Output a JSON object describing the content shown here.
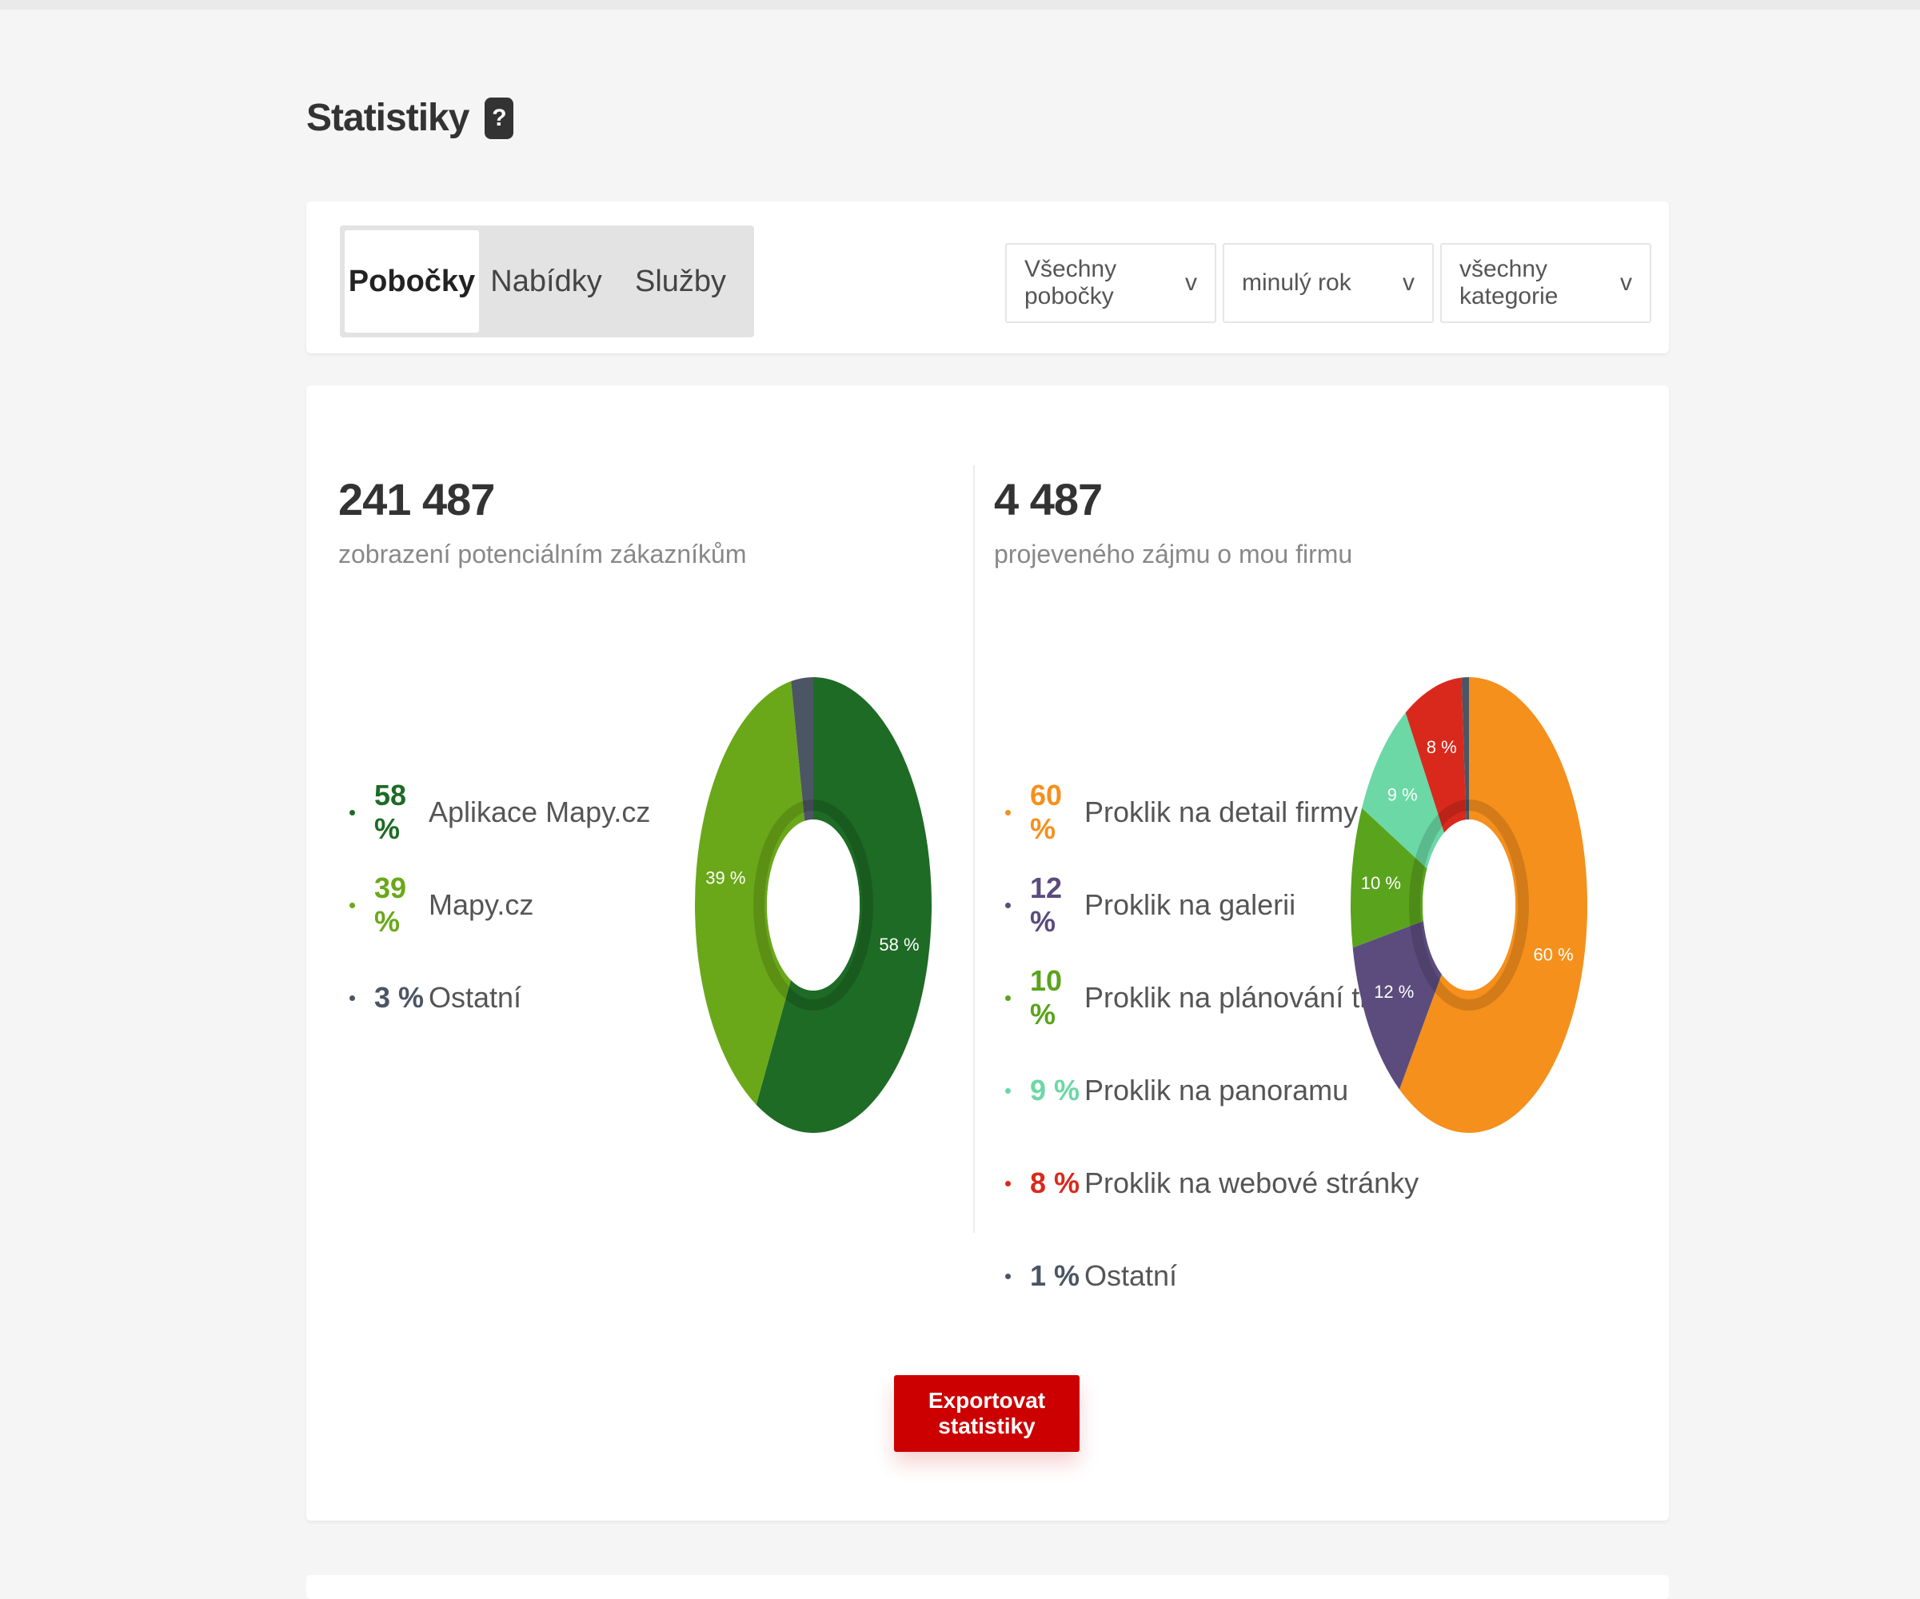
{
  "page": {
    "title": "Statistiky",
    "help_icon": "?"
  },
  "tabs": [
    {
      "label": "Pobočky",
      "active": true
    },
    {
      "label": "Nabídky",
      "active": false
    },
    {
      "label": "Služby",
      "active": false
    }
  ],
  "filters": {
    "branch": "Všechny pobočky",
    "period": "minulý rok",
    "category": "všechny kategorie",
    "chevron": "v"
  },
  "left_panel": {
    "number": "241 487",
    "subtitle": "zobrazení potenciálním zákazníkům",
    "legend": [
      {
        "pct": "58 %",
        "label": "Aplikace Mapy.cz",
        "color": "#1e6b25"
      },
      {
        "pct": "39 %",
        "label": "Mapy.cz",
        "color": "#6aa819"
      },
      {
        "pct": "3 %",
        "label": "Ostatní",
        "color": "#4c5564"
      }
    ]
  },
  "right_panel": {
    "number": "4 487",
    "subtitle": "projeveného zájmu o mou firmu",
    "legend": [
      {
        "pct": "60 %",
        "label": "Proklik na detail firmy",
        "color": "#f5901c"
      },
      {
        "pct": "12 %",
        "label": "Proklik na galerii",
        "color": "#5b4c7d"
      },
      {
        "pct": "10 %",
        "label": "Proklik na plánování trasy",
        "color": "#5aa31d"
      },
      {
        "pct": "9 %",
        "label": "Proklik na panoramu",
        "color": "#6bd8a6"
      },
      {
        "pct": "8 %",
        "label": "Proklik na webové stránky",
        "color": "#d9291d"
      },
      {
        "pct": "1 %",
        "label": "Ostatní",
        "color": "#4c5564"
      }
    ]
  },
  "export_button": "Exportovat statistiky",
  "chart_data": [
    {
      "type": "pie",
      "categories": [
        "Aplikace Mapy.cz",
        "Mapy.cz",
        "Ostatní"
      ],
      "values": [
        58,
        39,
        3
      ],
      "colors": [
        "#1e6b25",
        "#6aa819",
        "#4c5564"
      ],
      "slice_labels": [
        "58 %",
        "39 %",
        ""
      ]
    },
    {
      "type": "pie",
      "categories": [
        "Proklik na detail firmy",
        "Proklik na galerii",
        "Proklik na plánování trasy",
        "Proklik na panoramu",
        "Proklik na webové stránky",
        "Ostatní"
      ],
      "values": [
        60,
        12,
        10,
        9,
        8,
        1
      ],
      "colors": [
        "#f5901c",
        "#5b4c7d",
        "#5aa31d",
        "#6bd8a6",
        "#d9291d",
        "#4c5564"
      ],
      "slice_labels": [
        "60 %",
        "12 %",
        "10 %",
        "9 %",
        "8 %",
        ""
      ]
    }
  ]
}
